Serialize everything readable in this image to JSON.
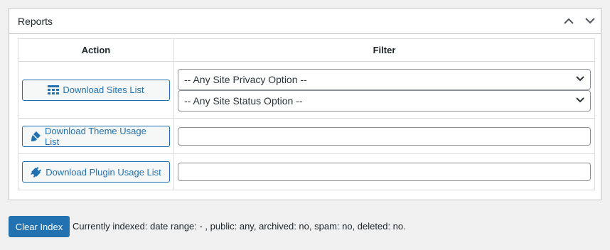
{
  "panel": {
    "title": "Reports",
    "collapse_icon": "chevron-up-icon",
    "expand_icon": "chevron-down-icon"
  },
  "table": {
    "headers": {
      "action": "Action",
      "filter": "Filter"
    },
    "rows": [
      {
        "button_label": "Download Sites List",
        "button_icon": "grid-list-icon",
        "filters": [
          {
            "type": "select",
            "value": "-- Any Site Privacy Option --"
          },
          {
            "type": "select",
            "value": "-- Any Site Status Option --"
          }
        ]
      },
      {
        "button_label": "Download Theme Usage List",
        "button_icon": "paintbrush-icon",
        "filters": [
          {
            "type": "text",
            "value": ""
          }
        ]
      },
      {
        "button_label": "Download Plugin Usage List",
        "button_icon": "plugin-icon",
        "filters": [
          {
            "type": "text",
            "value": ""
          }
        ]
      }
    ]
  },
  "footer": {
    "clear_button_label": "Clear Index",
    "status_text": "Currently indexed: date range: - , public: any, archived: no, spam: no, deleted: no."
  },
  "colors": {
    "accent": "#2271b1",
    "background": "#f0f0f1",
    "border": "#c3c4c7"
  }
}
